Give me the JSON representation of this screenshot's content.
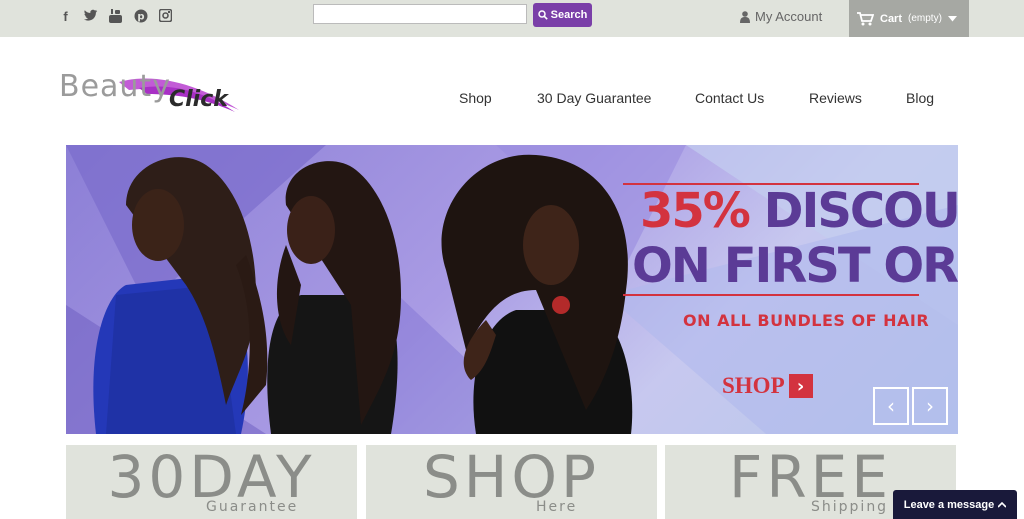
{
  "topbar": {
    "social_icons": [
      "facebook-icon",
      "twitter-icon",
      "youtube-icon",
      "pinterest-icon",
      "instagram-icon"
    ],
    "search": {
      "placeholder": "",
      "value": "",
      "button_label": "Search"
    },
    "account_label": "My Account",
    "cart": {
      "label": "Cart",
      "status": "(empty)"
    }
  },
  "logo": {
    "part1": "Beauty",
    "part2": "Click"
  },
  "nav": [
    "Shop",
    "30 Day Guarantee",
    "Contact Us",
    "Reviews",
    "Blog"
  ],
  "banner": {
    "headline_red": "35%",
    "headline_purple": "DISCOUNT",
    "headline_line2": "ON FIRST ORDER",
    "subline": "ON ALL BUNDLES OF HAIR",
    "cta_label": "SHOP"
  },
  "tiles": [
    {
      "big": "30DAY",
      "small": "Guarantee"
    },
    {
      "big": "SHOP",
      "small": "Here"
    },
    {
      "big": "FREE",
      "small": "Shipping"
    }
  ],
  "chat": {
    "label": "Leave a message"
  },
  "colors": {
    "accent": "#7a3fa8",
    "promo_red": "#d3333f",
    "promo_purple": "#5b3b96",
    "topbar_bg": "#e0e3dc",
    "tile_bg": "#e0e3dc"
  }
}
